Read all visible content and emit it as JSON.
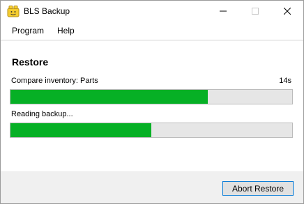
{
  "window": {
    "title": "BLS Backup",
    "app_icon": "lego-brick-icon"
  },
  "menu": {
    "items": [
      "Program",
      "Help"
    ]
  },
  "restore": {
    "heading": "Restore",
    "task_label": "Compare inventory: Parts",
    "task_time": "14s",
    "task_progress": 0.7,
    "status_label": "Reading backup...",
    "status_progress": 0.5
  },
  "footer": {
    "abort_label": "Abort Restore"
  },
  "colors": {
    "progress_fill": "#06b025",
    "progress_track": "#e6e6e6",
    "button_focus_border": "#0078d7"
  }
}
